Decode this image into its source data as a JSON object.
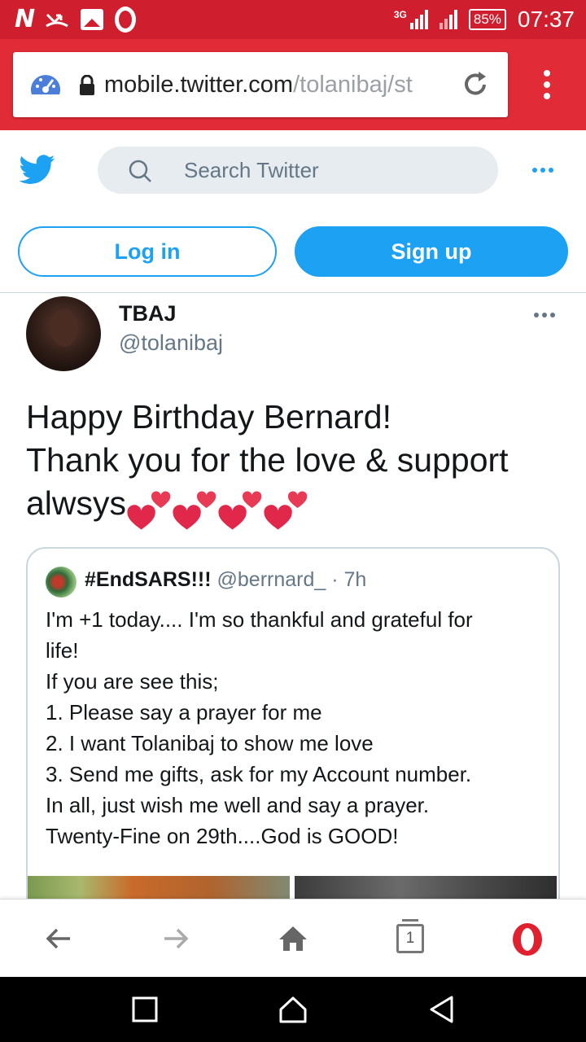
{
  "status_bar": {
    "network_type": "3G",
    "battery_percent": "85%",
    "time": "07:37",
    "notification_icons": [
      "netflix-n-icon",
      "missed-call-icon",
      "gallery-icon",
      "opera-icon"
    ]
  },
  "browser": {
    "url_domain": "mobile.twitter.com",
    "url_path": "/tolanibaj/st",
    "tab_count": "1"
  },
  "twitter": {
    "search_placeholder": "Search Twitter",
    "login_label": "Log in",
    "signup_label": "Sign up",
    "brand_color": "#1da1f2"
  },
  "tweet": {
    "author_name": "TBAJ",
    "author_handle": "@tolanibaj",
    "text_line1": "Happy Birthday Bernard!",
    "text_line2": "Thank you for the love & support",
    "text_line3": "alwsys",
    "heart_emoji_count": 4
  },
  "quoted_tweet": {
    "author_name": "#EndSARS!!!",
    "author_handle": "@berrnard_",
    "separator": "·",
    "time_ago": "7h",
    "lines": [
      "I'm +1 today.... I'm so thankful and grateful for",
      "life!",
      "If you are see this;",
      "1. Please say a prayer for me",
      "2. I want Tolanibaj to show me love",
      "3. Send me gifts, ask for my Account number.",
      "In all, just wish me well and say a prayer.",
      "Twenty-Fine on 29th....God is GOOD!"
    ]
  }
}
